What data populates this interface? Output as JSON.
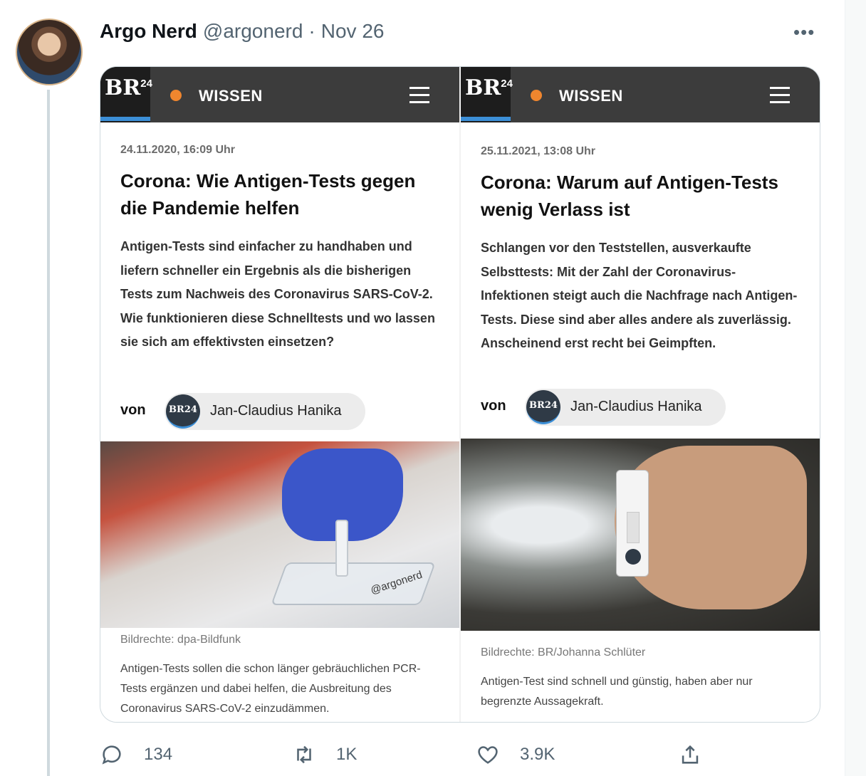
{
  "tweet": {
    "author_name": "Argo Nerd",
    "author_handle": "@argonerd",
    "separator": "·",
    "date": "Nov 26",
    "more_icon": "more-horizontal-icon"
  },
  "panels": [
    {
      "logo_text": "BR",
      "logo_sup": "24",
      "section": "WISSEN",
      "date": "24.11.2020, 16:09 Uhr",
      "title": "Corona: Wie Antigen-Tests gegen die Pandemie helfen",
      "lead": "Antigen-Tests sind einfacher zu handhaben und liefern schneller ein Ergebnis als die bisherigen Tests zum Nachweis des Coronavirus SARS-CoV-2. Wie funktionieren diese Schnelltests und wo lassen sie sich am effektivsten einsetzen?",
      "von": "von",
      "author_badge": "BR24",
      "author": "Jan-Claudius Hanika",
      "watermark": "@argonerd",
      "credit": "Bildrechte: dpa-Bildfunk",
      "caption": "Antigen-Tests sollen die schon länger gebräuchlichen PCR-Tests ergänzen und dabei helfen, die Ausbreitung des Coronavirus SARS-CoV-2 einzudämmen."
    },
    {
      "logo_text": "BR",
      "logo_sup": "24",
      "section": "WISSEN",
      "date": "25.11.2021, 13:08 Uhr",
      "title": "Corona: Warum auf Antigen-Tests wenig Verlass ist",
      "lead": "Schlangen vor den Teststellen, ausverkaufte Selbsttests: Mit der Zahl der Coronavirus-Infektionen steigt auch die Nachfrage nach Antigen-Tests. Diese sind aber alles andere als zuverlässig. Anscheinend erst recht bei Geimpften.",
      "von": "von",
      "author_badge": "BR24",
      "author": "Jan-Claudius Hanika",
      "credit": "Bildrechte: BR/Johanna Schlüter",
      "caption": "Antigen-Test sind schnell und günstig, haben aber nur begrenzte Aussagekraft."
    }
  ],
  "actions": {
    "reply_count": "134",
    "retweet_count": "1K",
    "like_count": "3.9K",
    "share_label": ""
  },
  "colors": {
    "accent_orange": "#f0862e",
    "br_blue": "#3c8fd7",
    "header_bar": "#3c3c3c",
    "glove_blue": "#3b56c9"
  }
}
